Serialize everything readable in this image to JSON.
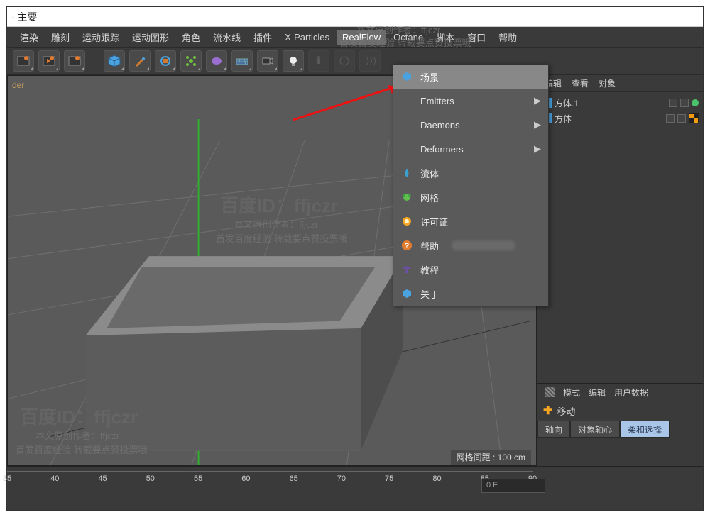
{
  "title": "- 主要",
  "menubar": [
    "渲染",
    "雕刻",
    "运动跟踪",
    "运动图形",
    "角色",
    "流水线",
    "插件",
    "X-Particles",
    "RealFlow",
    "Octane",
    "脚本",
    "窗口",
    "帮助"
  ],
  "menubar_active_index": 8,
  "viewport_label": "der",
  "dropdown": [
    {
      "label": "场景",
      "highlight": true,
      "icon": "scene"
    },
    {
      "label": "Emitters",
      "submenu": true
    },
    {
      "label": "Daemons",
      "submenu": true
    },
    {
      "label": "Deformers",
      "submenu": true
    },
    {
      "label": "流体",
      "icon": "fluid"
    },
    {
      "label": "网格",
      "icon": "mesh"
    },
    {
      "label": "许可证",
      "icon": "license"
    },
    {
      "label": "帮助",
      "icon": "help",
      "blur": true
    },
    {
      "label": "教程",
      "icon": "tutorial"
    },
    {
      "label": "关于",
      "icon": "about"
    }
  ],
  "right_panel": {
    "menu": [
      "编辑",
      "查看",
      "对象"
    ],
    "objects": [
      {
        "name": "方体.1",
        "check": true
      },
      {
        "name": "方体",
        "chk": true
      }
    ],
    "attrib_menu": [
      "模式",
      "编辑",
      "用户数据"
    ],
    "move_label": "移动",
    "tabs": [
      "轴向",
      "对象轴心",
      "柔和选择"
    ],
    "tab_active": 2
  },
  "status": "网格间距 : 100 cm",
  "timeline_field": "0 F",
  "ruler": [
    "35",
    "40",
    "45",
    "50",
    "55",
    "60",
    "65",
    "70",
    "75",
    "80",
    "85",
    "90"
  ],
  "watermarks": {
    "big": "百度ID：ffjczr",
    "line1": "本文原创作者：ffjczr",
    "line2": "首发百度经验 转载要点赞投票哦"
  }
}
